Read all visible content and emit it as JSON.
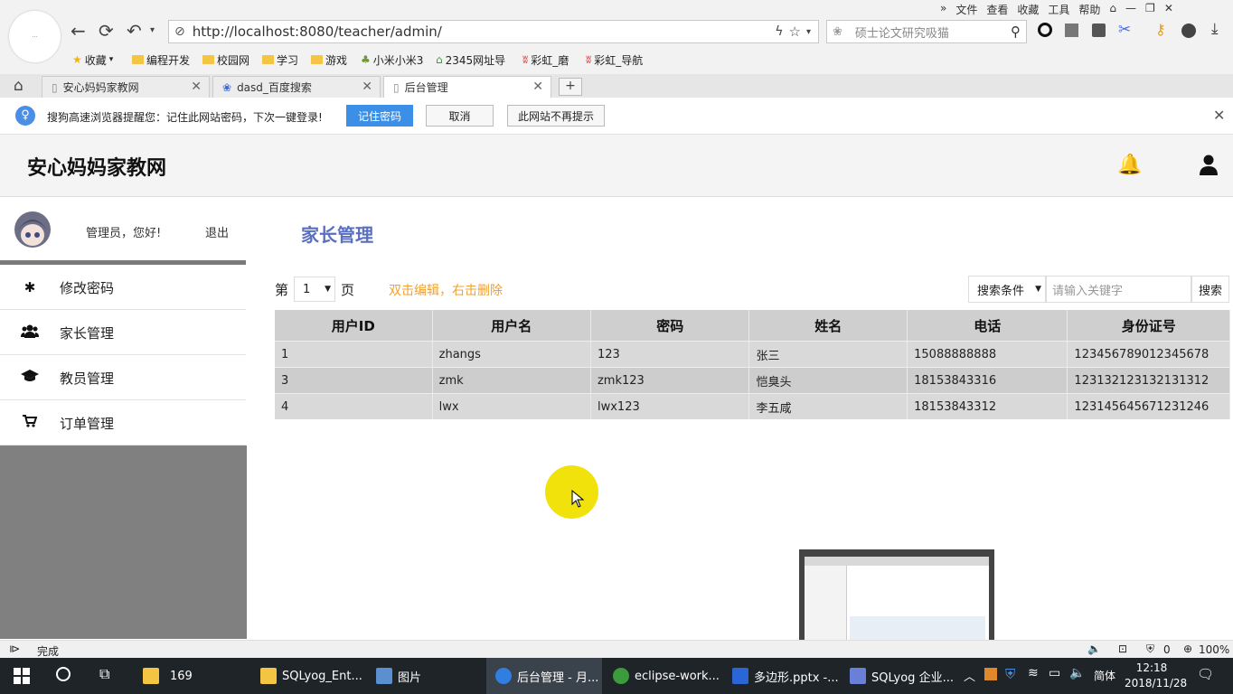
{
  "browser": {
    "menu": [
      "»",
      "文件",
      "查看",
      "收藏",
      "工具",
      "帮助"
    ],
    "url": "http://localhost:8080/teacher/admin/",
    "search_placeholder": "硕士论文研究吸猫",
    "bookmarks": [
      "收藏",
      "编程开发",
      "校园网",
      "学习",
      "游戏",
      "小米小米3",
      "2345网址导",
      "彩虹_磨",
      "彩虹_导航"
    ],
    "tabs": [
      {
        "label": "安心妈妈家教网"
      },
      {
        "label": "dasd_百度搜索"
      },
      {
        "label": "后台管理"
      }
    ],
    "notice": {
      "text": "搜狗高速浏览器提醒您：记住此网站密码，下次一键登录!",
      "remember": "记住密码",
      "cancel": "取消",
      "never": "此网站不再提示"
    },
    "status": "完成",
    "status_count": "0",
    "zoom": "100%"
  },
  "site": {
    "title": "安心妈妈家教网",
    "greeting": "管理员，您好!",
    "logout": "退出",
    "menu": [
      {
        "icon": "asterisk-icon",
        "label": "修改密码"
      },
      {
        "icon": "users-icon",
        "label": "家长管理"
      },
      {
        "icon": "graduation-cap-icon",
        "label": "教员管理"
      },
      {
        "icon": "cart-icon",
        "label": "订单管理"
      }
    ]
  },
  "main": {
    "title": "家长管理",
    "page_prefix": "第",
    "page_value": "1",
    "page_suffix": "页",
    "hint": "双击编辑，右击删除",
    "search_condition": "搜索条件",
    "search_placeholder": "请输入关键字",
    "search_button": "搜索",
    "columns": [
      "用户ID",
      "用户名",
      "密码",
      "姓名",
      "电话",
      "身份证号"
    ],
    "rows": [
      [
        "1",
        "zhangs",
        "123",
        "张三",
        "15088888888",
        "123456789012345678"
      ],
      [
        "3",
        "zmk",
        "zmk123",
        "恺臭头",
        "18153843316",
        "123132123132131312"
      ],
      [
        "4",
        "lwx",
        "lwx123",
        "李五咸",
        "18153843312",
        "123145645671231246"
      ]
    ]
  },
  "taskbar": {
    "items": [
      "169",
      "SQLyog_Ent...",
      "图片",
      "后台管理 - 月...",
      "eclipse-work...",
      "多边形.pptx -...",
      "SQLyog 企业..."
    ],
    "lang": "简体",
    "time": "12:18",
    "date": "2018/11/28"
  },
  "colors": {
    "accent": "#5a6fbf",
    "hint": "#f0a030",
    "notice_btn": "#3b8fe6",
    "taskbar": "#1f2429"
  }
}
